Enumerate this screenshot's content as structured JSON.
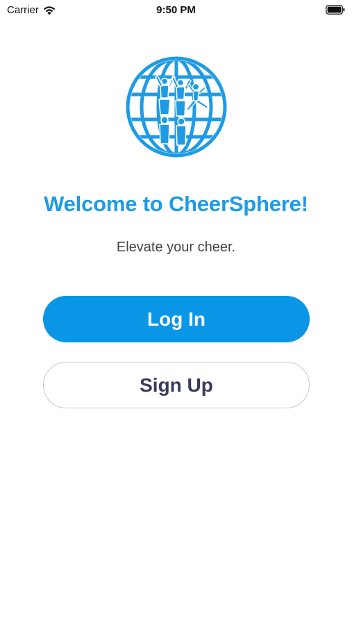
{
  "status_bar": {
    "carrier": "Carrier",
    "time": "9:50 PM",
    "icons": [
      "wifi-icon",
      "battery-icon"
    ]
  },
  "logo": {
    "icon": "cheerleader-globe-logo",
    "color": "#1e9be4"
  },
  "welcome": {
    "title": "Welcome to CheerSphere!",
    "tagline": "Elevate your cheer."
  },
  "actions": {
    "login_label": "Log In",
    "signup_label": "Sign Up"
  },
  "colors": {
    "brand": "#1e9be4",
    "primary_button": "#0a96e6",
    "secondary_text": "#3a3a5e"
  }
}
